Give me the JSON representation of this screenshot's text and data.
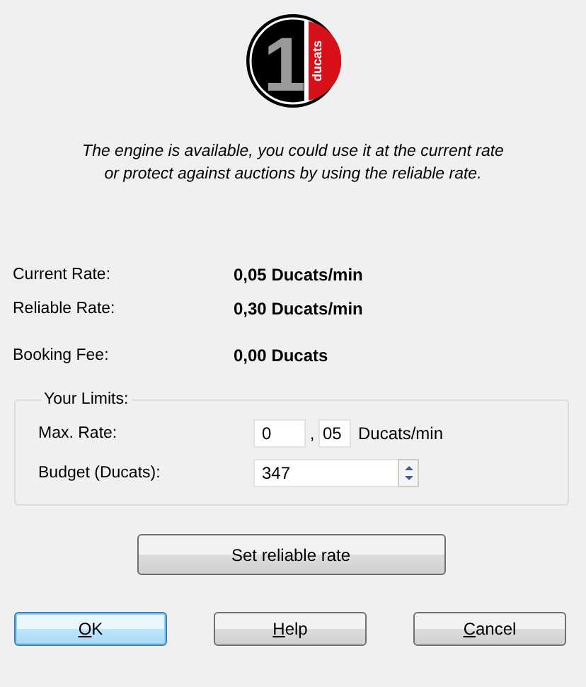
{
  "logo": {
    "numeral": "1",
    "word": "ducats"
  },
  "message": [
    "The engine is available, you could use it at the current rate",
    "or protect against auctions by using the reliable rate."
  ],
  "rates": [
    {
      "label": "Current Rate:",
      "value": "0,05 Ducats/min"
    },
    {
      "label": "Reliable Rate:",
      "value": "0,30 Ducats/min"
    },
    {
      "label": "Booking Fee:",
      "value": "0,00 Ducats"
    }
  ],
  "limits": {
    "title": "Your Limits:",
    "max_rate": {
      "label": "Max. Rate:",
      "whole": "0",
      "separator": ",",
      "fraction": "05",
      "unit": "Ducats/min"
    },
    "budget": {
      "label": "Budget (Ducats):",
      "value": "347"
    }
  },
  "action_button": "Set reliable rate",
  "buttons": [
    {
      "mnemonic": "O",
      "rest": "K",
      "default": true
    },
    {
      "mnemonic": "H",
      "rest": "elp",
      "default": false
    },
    {
      "mnemonic": "C",
      "rest": "ancel",
      "default": false
    }
  ]
}
